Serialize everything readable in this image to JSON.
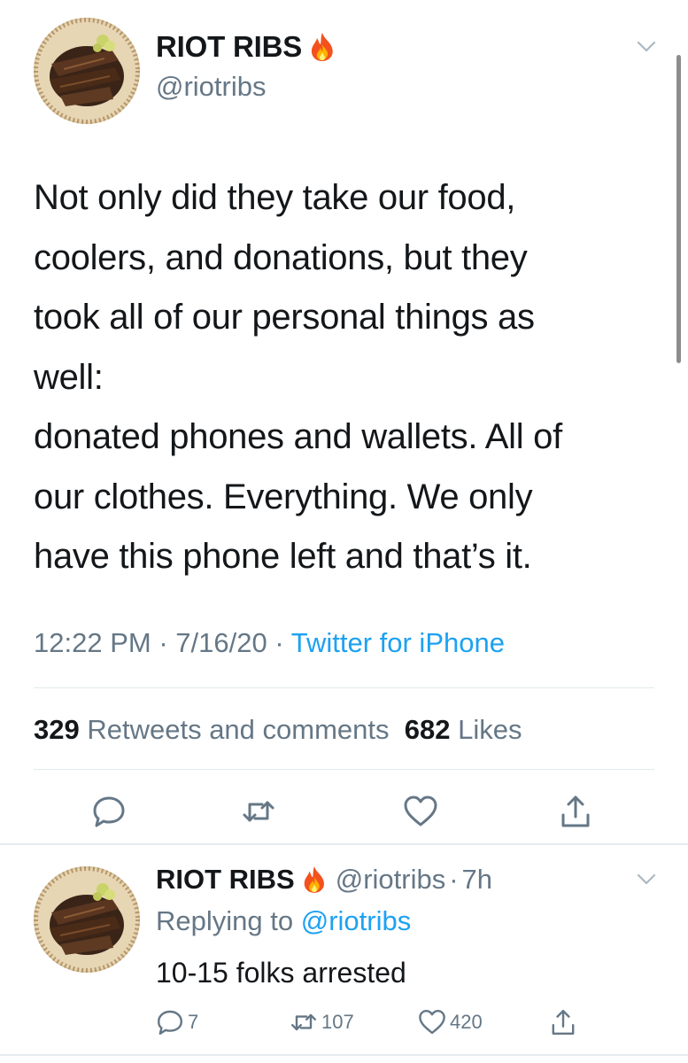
{
  "main_tweet": {
    "display_name": "RIOT RIBS",
    "handle": "@riotribs",
    "text_lines": [
      "Not only did they take our food,",
      "coolers, and donations, but they",
      "took all of our personal things as",
      "well:",
      "donated phones and wallets. All of",
      "our clothes. Everything. We only",
      "have this phone left and that’s it."
    ],
    "time": "12:22 PM",
    "date": "7/16/20",
    "separator": "·",
    "source": "Twitter for iPhone",
    "retweets_count": "329",
    "retweets_label": "Retweets and comments",
    "likes_count": "682",
    "likes_label": "Likes"
  },
  "reply_tweet": {
    "display_name": "RIOT RIBS",
    "handle": "@riotribs",
    "separator": "·",
    "time_ago": "7h",
    "replying_label": "Replying to",
    "replying_to": "@riotribs",
    "text": "10-15 folks arrested",
    "reply_count": "7",
    "retweet_count": "107",
    "like_count": "420"
  },
  "icons": {
    "verified_emoji": "fire-icon",
    "menu": "chevron-down-icon",
    "reply": "comment-icon",
    "retweet": "retweet-icon",
    "like": "heart-icon",
    "share": "share-icon"
  },
  "colors": {
    "link": "#1da1f2",
    "secondary_text": "#657786",
    "primary_text": "#14171a",
    "divider": "#e1e8ed"
  }
}
